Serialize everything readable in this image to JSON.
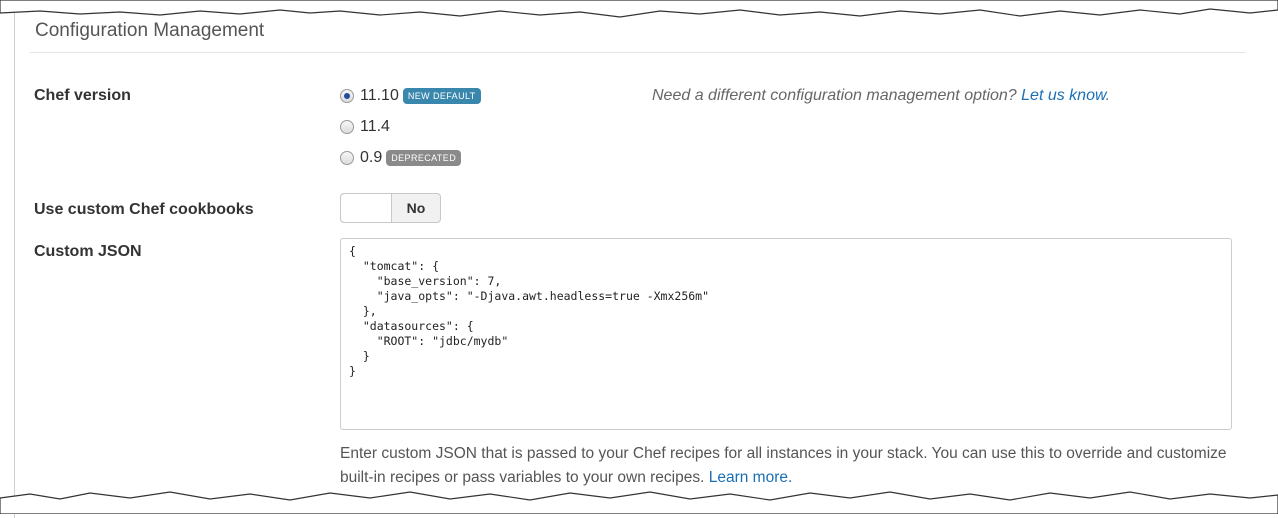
{
  "section": {
    "title": "Configuration Management"
  },
  "chef_version": {
    "label": "Chef version",
    "options": [
      {
        "value": "11.10",
        "badge": "NEW DEFAULT",
        "badge_color": "#3a87ad",
        "checked": true
      },
      {
        "value": "11.4",
        "checked": false
      },
      {
        "value": "0.9",
        "badge": "DEPRECATED",
        "badge_color": "#8a8a8a",
        "checked": false
      }
    ],
    "hint_text": "Need a different configuration management option?",
    "hint_link": "Let us know",
    "hint_suffix": "."
  },
  "custom_cookbooks": {
    "label": "Use custom Chef cookbooks",
    "toggle_value": "No"
  },
  "custom_json": {
    "label": "Custom JSON",
    "value": "{\n  \"tomcat\": {\n    \"base_version\": 7,\n    \"java_opts\": \"-Djava.awt.headless=true -Xmx256m\"\n  },\n  \"datasources\": {\n    \"ROOT\": \"jdbc/mydb\"\n  }\n}",
    "help_text": "Enter custom JSON that is passed to your Chef recipes for all instances in your stack. You can use this to override and customize built-in recipes or pass variables to your own recipes.",
    "help_link": "Learn more."
  }
}
